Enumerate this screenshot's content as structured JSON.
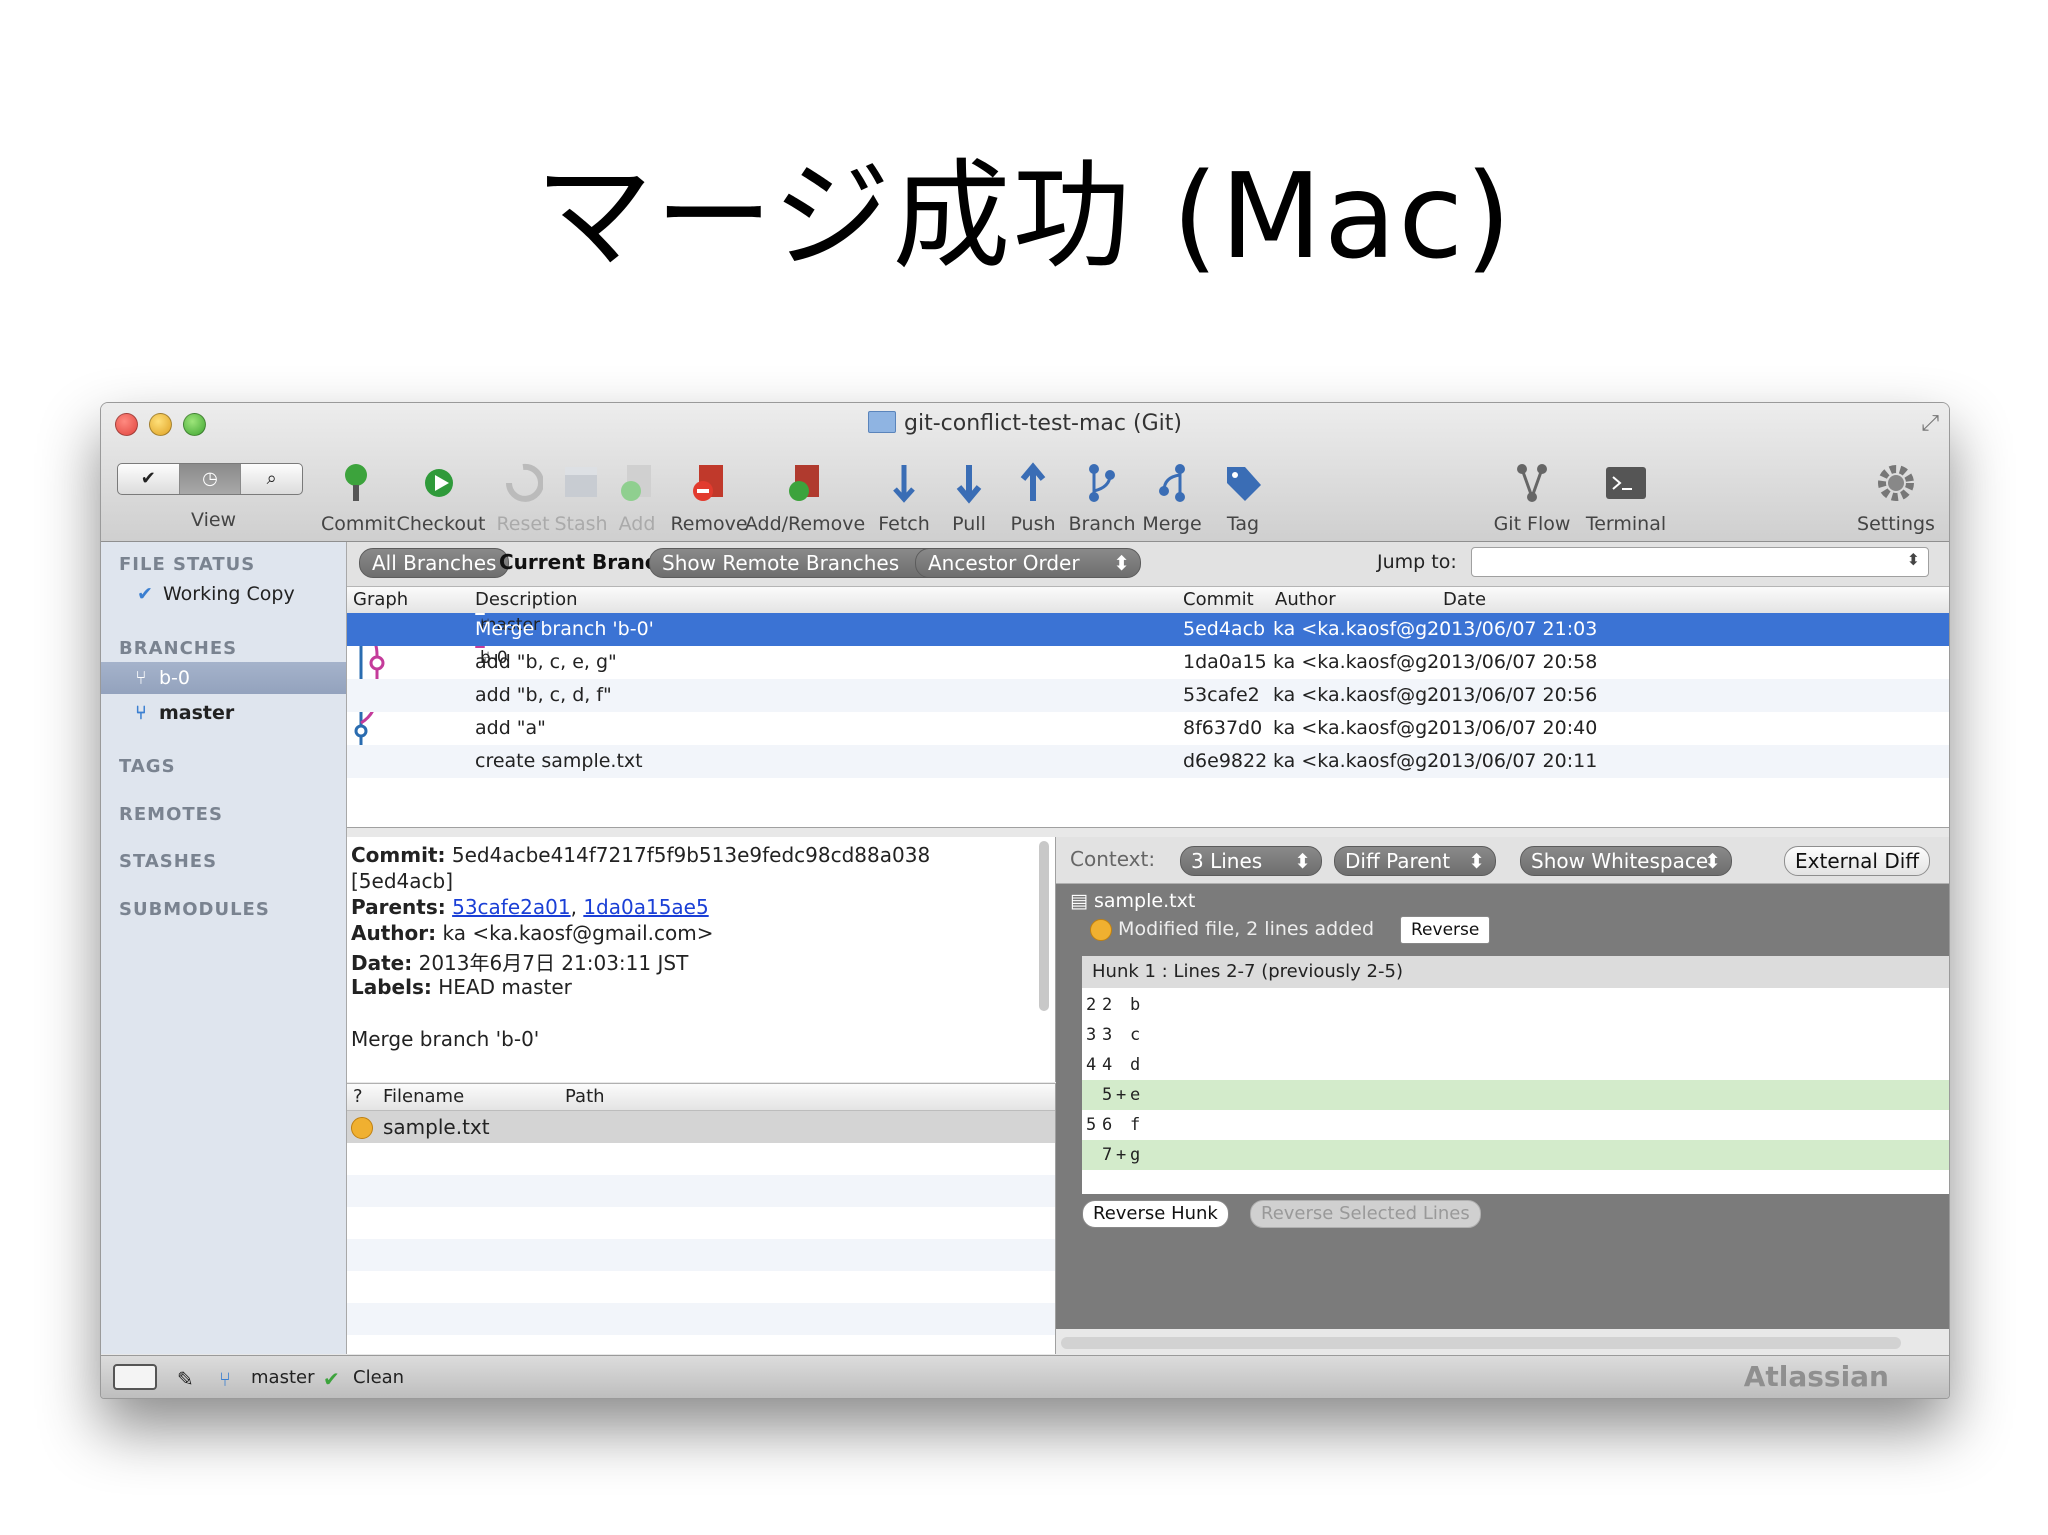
{
  "slide": {
    "title": "マージ成功 (Mac)"
  },
  "window": {
    "title": "git-conflict-test-mac (Git)"
  },
  "toolbar": {
    "view_label": "View",
    "items": [
      {
        "label": "Commit"
      },
      {
        "label": "Checkout"
      },
      {
        "label": "Reset"
      },
      {
        "label": "Stash"
      },
      {
        "label": "Add"
      },
      {
        "label": "Remove"
      },
      {
        "label": "Add/Remove"
      },
      {
        "label": "Fetch"
      },
      {
        "label": "Pull"
      },
      {
        "label": "Push"
      },
      {
        "label": "Branch"
      },
      {
        "label": "Merge"
      },
      {
        "label": "Tag"
      },
      {
        "label": "Git Flow"
      },
      {
        "label": "Terminal"
      },
      {
        "label": "Settings"
      }
    ]
  },
  "sidebar": {
    "file_status": "FILE STATUS",
    "working_copy": "Working Copy",
    "branches": "BRANCHES",
    "branch_items": [
      "b-0",
      "master"
    ],
    "tags": "TAGS",
    "remotes": "REMOTES",
    "stashes": "STASHES",
    "submodules": "SUBMODULES"
  },
  "filters": {
    "all_branches": "All Branches",
    "current_branch": "Current Branch",
    "show_remote": "Show Remote Branches",
    "order": "Ancestor Order",
    "jump_to": "Jump to:"
  },
  "log": {
    "headers": {
      "graph": "Graph",
      "description": "Description",
      "commit": "Commit",
      "author": "Author",
      "date": "Date"
    },
    "rows": [
      {
        "tag": "master",
        "description": "Merge branch 'b-0'",
        "commit": "5ed4acb",
        "author": "ka <ka.kaosf@g...",
        "date": "2013/06/07 21:03"
      },
      {
        "tag": "b-0",
        "description": "add \"b, c, e, g\"",
        "commit": "1da0a15",
        "author": "ka <ka.kaosf@g...",
        "date": "2013/06/07 20:58"
      },
      {
        "tag": "",
        "description": "add \"b, c, d, f\"",
        "commit": "53cafe2",
        "author": "ka <ka.kaosf@g...",
        "date": "2013/06/07 20:56"
      },
      {
        "tag": "",
        "description": "add \"a\"",
        "commit": "8f637d0",
        "author": "ka <ka.kaosf@g...",
        "date": "2013/06/07 20:40"
      },
      {
        "tag": "",
        "description": "create sample.txt",
        "commit": "d6e9822",
        "author": "ka <ka.kaosf@g...",
        "date": "2013/06/07 20:11"
      }
    ]
  },
  "details": {
    "commit_label": "Commit:",
    "commit_value": "5ed4acbe414f7217f5f9b513e9fedc98cd88a038",
    "short": "[5ed4acb]",
    "parents_label": "Parents:",
    "parent1": "53cafe2a01",
    "parent_sep": ",",
    "parent2": "1da0a15ae5",
    "author_label": "Author:",
    "author_value": "ka <ka.kaosf@gmail.com>",
    "date_label": "Date:",
    "date_value": "2013年6月7日 21:03:11 JST",
    "labels_label": "Labels:",
    "labels_value": "HEAD master",
    "message": "Merge branch 'b-0'"
  },
  "files": {
    "headers": {
      "status": "?",
      "filename": "Filename",
      "path": "Path"
    },
    "rows": [
      {
        "filename": "sample.txt"
      }
    ]
  },
  "diff": {
    "context_label": "Context:",
    "context_value": "3 Lines",
    "diff_parent": "Diff Parent",
    "show_whitespace": "Show Whitespace",
    "external_diff": "External Diff",
    "file": "sample.txt",
    "status": "Modified file, 2 lines added",
    "reverse": "Reverse",
    "hunk_header": "Hunk 1 : Lines 2-7 (previously 2-5)",
    "lines": [
      {
        "old": "2",
        "new": "2",
        "sign": "",
        "text": "b",
        "added": false
      },
      {
        "old": "3",
        "new": "3",
        "sign": "",
        "text": "c",
        "added": false
      },
      {
        "old": "4",
        "new": "4",
        "sign": "",
        "text": "d",
        "added": false
      },
      {
        "old": "",
        "new": "5",
        "sign": "+",
        "text": "e",
        "added": true
      },
      {
        "old": "5",
        "new": "6",
        "sign": "",
        "text": "f",
        "added": false
      },
      {
        "old": "",
        "new": "7",
        "sign": "+",
        "text": "g",
        "added": true
      }
    ],
    "reverse_hunk": "Reverse Hunk",
    "reverse_selected": "Reverse Selected Lines"
  },
  "status": {
    "branch": "master",
    "state": "Clean",
    "brand": "Atlassian"
  },
  "colors": {
    "selection": "#3b73d4",
    "added_line": "#d3ebcb",
    "graph_line": "#c43b9a",
    "graph_node": "#2a6cb0"
  }
}
